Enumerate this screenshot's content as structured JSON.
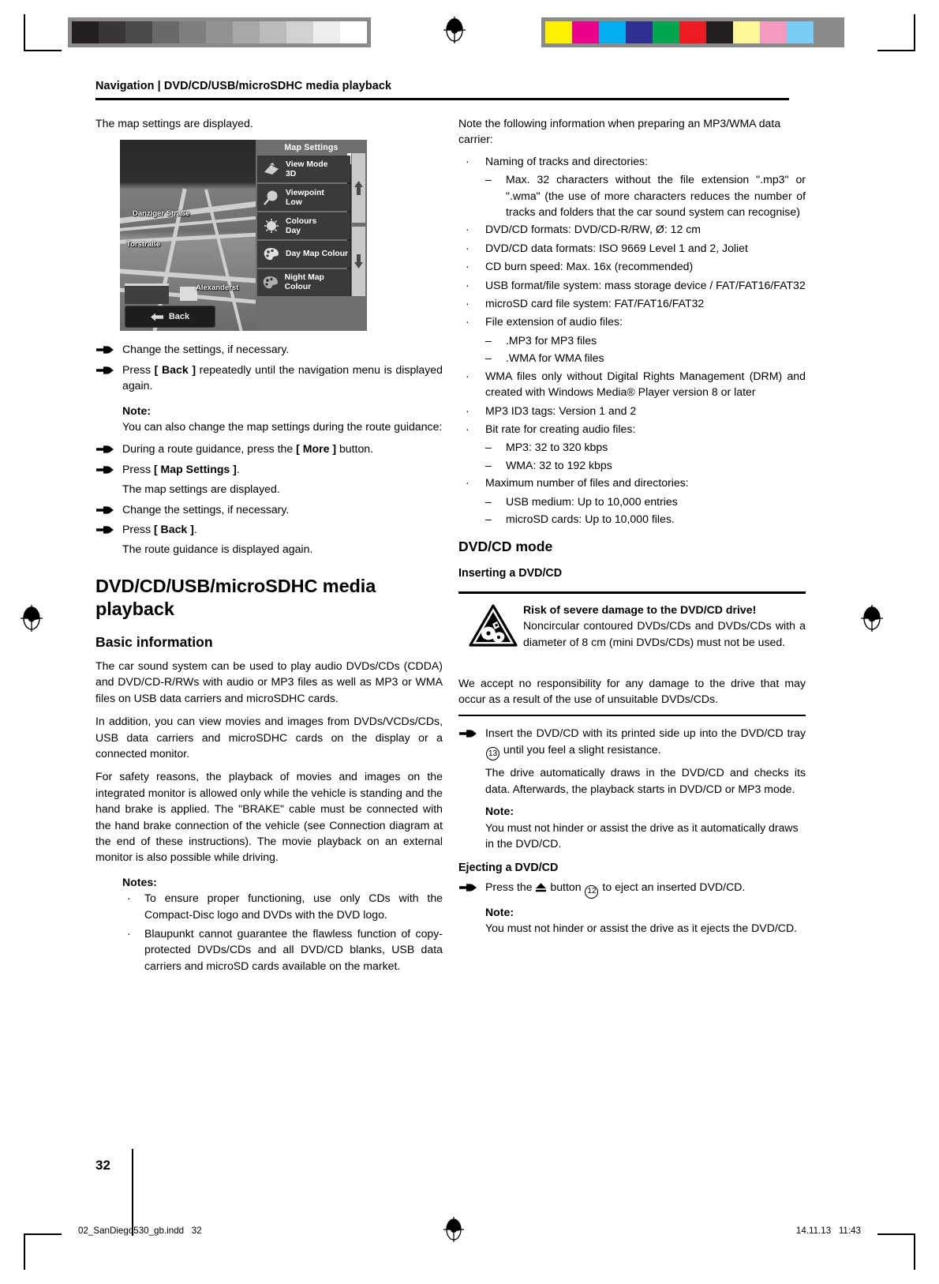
{
  "print_marks": {
    "gray_swatches": [
      "#231f20",
      "#3a3637",
      "#4d4a4b",
      "#6b6869",
      "#807d7e",
      "#949192",
      "#a9a6a7",
      "#bcbabb",
      "#d2d0d1",
      "#eeecec",
      "#ffffff"
    ],
    "color_swatches": [
      "#fff200",
      "#ec008c",
      "#00aeef",
      "#2e3192",
      "#00a651",
      "#ed1c24",
      "#231f20",
      "#fff79a",
      "#f49ac1",
      "#7accf5",
      "#8a8a8a"
    ],
    "registration_icon": "registration-target-icon"
  },
  "header": {
    "running_head": "Navigation | DVD/CD/USB/microSDHC media playback"
  },
  "screenshot": {
    "caption_above": "The map settings are displayed.",
    "panel_title": "Map Settings",
    "street_labels": [
      "Danziger Straße",
      "Torstraße",
      "Alexanderst"
    ],
    "back_button": "Back",
    "menu_items": [
      {
        "label": "View Mode",
        "value": "3D",
        "icon": "view-mode-icon"
      },
      {
        "label": "Viewpoint",
        "value": "Low",
        "icon": "viewpoint-icon"
      },
      {
        "label": "Colours",
        "value": "Day",
        "icon": "colours-icon"
      },
      {
        "label": "Day Map Colour",
        "value": "",
        "icon": "palette-icon"
      },
      {
        "label": "Night Map Colour",
        "value": "",
        "icon": "palette-night-icon"
      }
    ],
    "scroll_up_icon": "arrow-up-icon",
    "scroll_down_icon": "arrow-down-icon"
  },
  "left_column": {
    "steps": [
      {
        "text": "Change the settings, if necessary."
      },
      {
        "pre": "Press ",
        "bold": "[ Back ]",
        "post": " repeatedly until the navigation menu is displayed again."
      }
    ],
    "note1_label": "Note:",
    "note1_text": "You can also change the map settings during the route guidance:",
    "step_more": {
      "pre": "During a route guidance, press the ",
      "bold": "[ More ]",
      "post": " button."
    },
    "step_mapsettings": {
      "pre": "Press ",
      "bold": "[ Map Settings ]",
      "post": "."
    },
    "result_map_settings": "The map settings are displayed.",
    "step_change2": "Change the settings, if necessary.",
    "step_back2": {
      "pre": "Press ",
      "bold": "[ Back ]",
      "post": "."
    },
    "result_route_guidance": "The route guidance is displayed again.",
    "section_title": "DVD/CD/USB/microSDHC media playback",
    "basic_info_title": "Basic information",
    "basic_paragraphs": [
      "The car sound system can be used to play audio DVDs/CDs (CDDA) and DVD/CD-R/RWs with audio or MP3 files as well as MP3 or WMA files on USB data carriers and microSDHC cards.",
      "In addition, you can view movies and images from DVDs/VCDs/CDs, USB data carriers and microSDHC cards on the display or a connected monitor.",
      "For safety reasons, the playback of movies and images on the integrated monitor is allowed only while the vehicle is standing and the hand brake is applied. The \"BRAKE\" cable must be connected with the hand brake connection of the vehicle (see Connection diagram at the end of these instructions). The movie playback on an external monitor is also possible while driving."
    ],
    "notes_label": "Notes:",
    "notes_items": [
      "To ensure proper functioning, use only CDs with the Compact-Disc logo and DVDs with the DVD logo.",
      "Blaupunkt cannot guarantee the flawless function of copy-protected DVDs/CDs and all DVD/CD blanks, USB data carriers and microSD cards available on the market."
    ]
  },
  "right_column": {
    "intro": "Note the following information when preparing an MP3/WMA data carrier:",
    "spec_bullets": [
      {
        "text": "Naming of tracks and directories:",
        "subs": [
          "Max. 32 characters without the file extension \".mp3\" or \".wma\" (the use of more characters reduces the number of tracks and folders that the car sound system can recognise)"
        ]
      },
      {
        "text": "DVD/CD formats: DVD/CD-R/RW, Ø: 12 cm",
        "subs": []
      },
      {
        "text": "DVD/CD data formats: ISO 9669 Level 1 and 2, Joliet",
        "subs": []
      },
      {
        "text": "CD burn speed: Max. 16x (recommended)",
        "subs": []
      },
      {
        "text": "USB format/file system: mass storage device / FAT/FAT16/FAT32",
        "subs": []
      },
      {
        "text": "microSD card file system: FAT/FAT16/FAT32",
        "subs": []
      },
      {
        "text": "File extension of audio files:",
        "subs": [
          ".MP3 for MP3 files",
          ".WMA for WMA files"
        ]
      },
      {
        "text": "WMA files only without Digital Rights Management (DRM) and created with Windows Media® Player version 8 or later",
        "subs": []
      },
      {
        "text": "MP3 ID3 tags: Version 1 and 2",
        "subs": []
      },
      {
        "text": "Bit rate for creating audio files:",
        "subs": [
          "MP3: 32 to 320 kbps",
          "WMA: 32 to 192 kbps"
        ]
      },
      {
        "text": "Maximum number of files and directories:",
        "subs": [
          "USB medium: Up to 10,000 entries",
          "microSD cards: Up to 10,000 files."
        ]
      }
    ],
    "mode_title": "DVD/CD mode",
    "inserting_title": "Inserting a DVD/CD",
    "warning": {
      "icon": "warning-triangle-broken-disc-icon",
      "title": "Risk of severe damage to the DVD/CD drive!",
      "text": "Noncircular contoured DVDs/CDs and DVDs/CDs with a diameter of 8 cm (mini DVDs/CDs) must not be used."
    },
    "disclaimer": "We accept no responsibility for any damage to the drive that may occur as a result of the use of unsuitable DVDs/CDs.",
    "insert_step": {
      "pre": "Insert the DVD/CD with its printed side up into the DVD/CD tray ",
      "ref": "13",
      "post": " until you feel a slight resistance."
    },
    "insert_result": "The drive automatically draws in the DVD/CD and checks its data. Afterwards, the playback starts in DVD/CD or MP3 mode.",
    "note2_label": "Note:",
    "note2_text": "You must not hinder or assist the drive as it automatically draws in the DVD/CD.",
    "ejecting_title": "Ejecting a DVD/CD",
    "eject_step": {
      "pre": "Press the ",
      "icon": "eject-icon",
      "mid": " button ",
      "ref": "12",
      "post": " to eject an inserted DVD/CD."
    },
    "note3_label": "Note:",
    "note3_text": "You must not hinder or assist the drive as it ejects the DVD/CD."
  },
  "footer": {
    "page_number": "32",
    "file_name": "02_SanDiego530_gb.indd",
    "file_page": "32",
    "date": "14.11.13",
    "time": "11:43"
  }
}
